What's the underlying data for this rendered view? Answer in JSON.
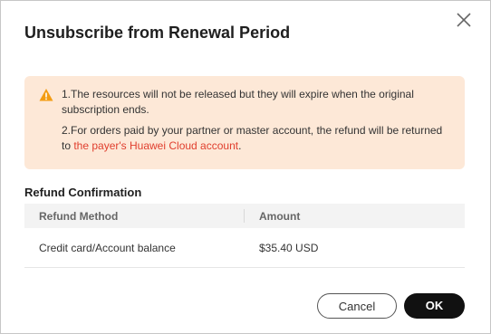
{
  "dialog": {
    "title": "Unsubscribe from Renewal Period",
    "close_icon": "close-icon"
  },
  "notice": {
    "icon": "warning-icon",
    "line1": "1.The resources will not be released but they will expire when the original subscription ends.",
    "line2_prefix": "2.For orders paid by your partner or master account, the refund will be returned to ",
    "line2_link": "the payer's Huawei Cloud account",
    "line2_suffix": ".",
    "bg_color": "#fde8d7",
    "link_color": "#e03e2d"
  },
  "refund": {
    "section_title": "Refund Confirmation",
    "columns": [
      "Refund Method",
      "Amount"
    ],
    "rows": [
      {
        "method": "Credit card/Account balance",
        "amount": "$35.40 USD"
      }
    ]
  },
  "footer": {
    "cancel_label": "Cancel",
    "ok_label": "OK"
  }
}
